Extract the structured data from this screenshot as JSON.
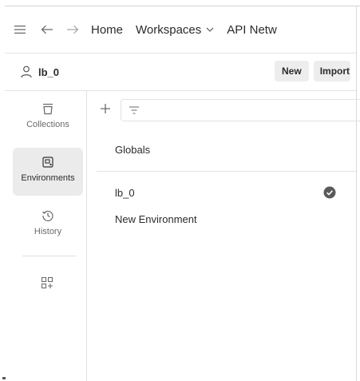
{
  "header": {
    "hamburger_icon": "menu-icon",
    "back_icon": "arrow-left-icon",
    "forward_icon": "arrow-right-icon",
    "nav": [
      {
        "label": "Home"
      },
      {
        "label": "Workspaces",
        "icon": "chevron-down-icon"
      },
      {
        "label": "API Netw"
      }
    ]
  },
  "workspace": {
    "icon": "user-icon",
    "name": "lb_0",
    "new_label": "New",
    "import_label": "Import"
  },
  "sidebar": {
    "items": [
      {
        "label": "Collections",
        "icon": "collections-icon",
        "active": false
      },
      {
        "label": "Environments",
        "icon": "environments-icon",
        "active": true
      },
      {
        "label": "History",
        "icon": "history-icon",
        "active": false
      }
    ],
    "extra_icon": "configure-sidebar-icon"
  },
  "main": {
    "add_icon": "plus-icon",
    "filter_icon": "filter-icon",
    "globals_label": "Globals",
    "environments": [
      {
        "name": "lb_0",
        "active": true,
        "status_icon": "check-circle-icon"
      },
      {
        "name": "New Environment",
        "active": false
      }
    ]
  },
  "colors": {
    "active_bg": "#ebebeb",
    "border": "#e2e2e2",
    "text": "#212121",
    "muted": "#6b6b6b",
    "check": "#5a5a5a"
  }
}
